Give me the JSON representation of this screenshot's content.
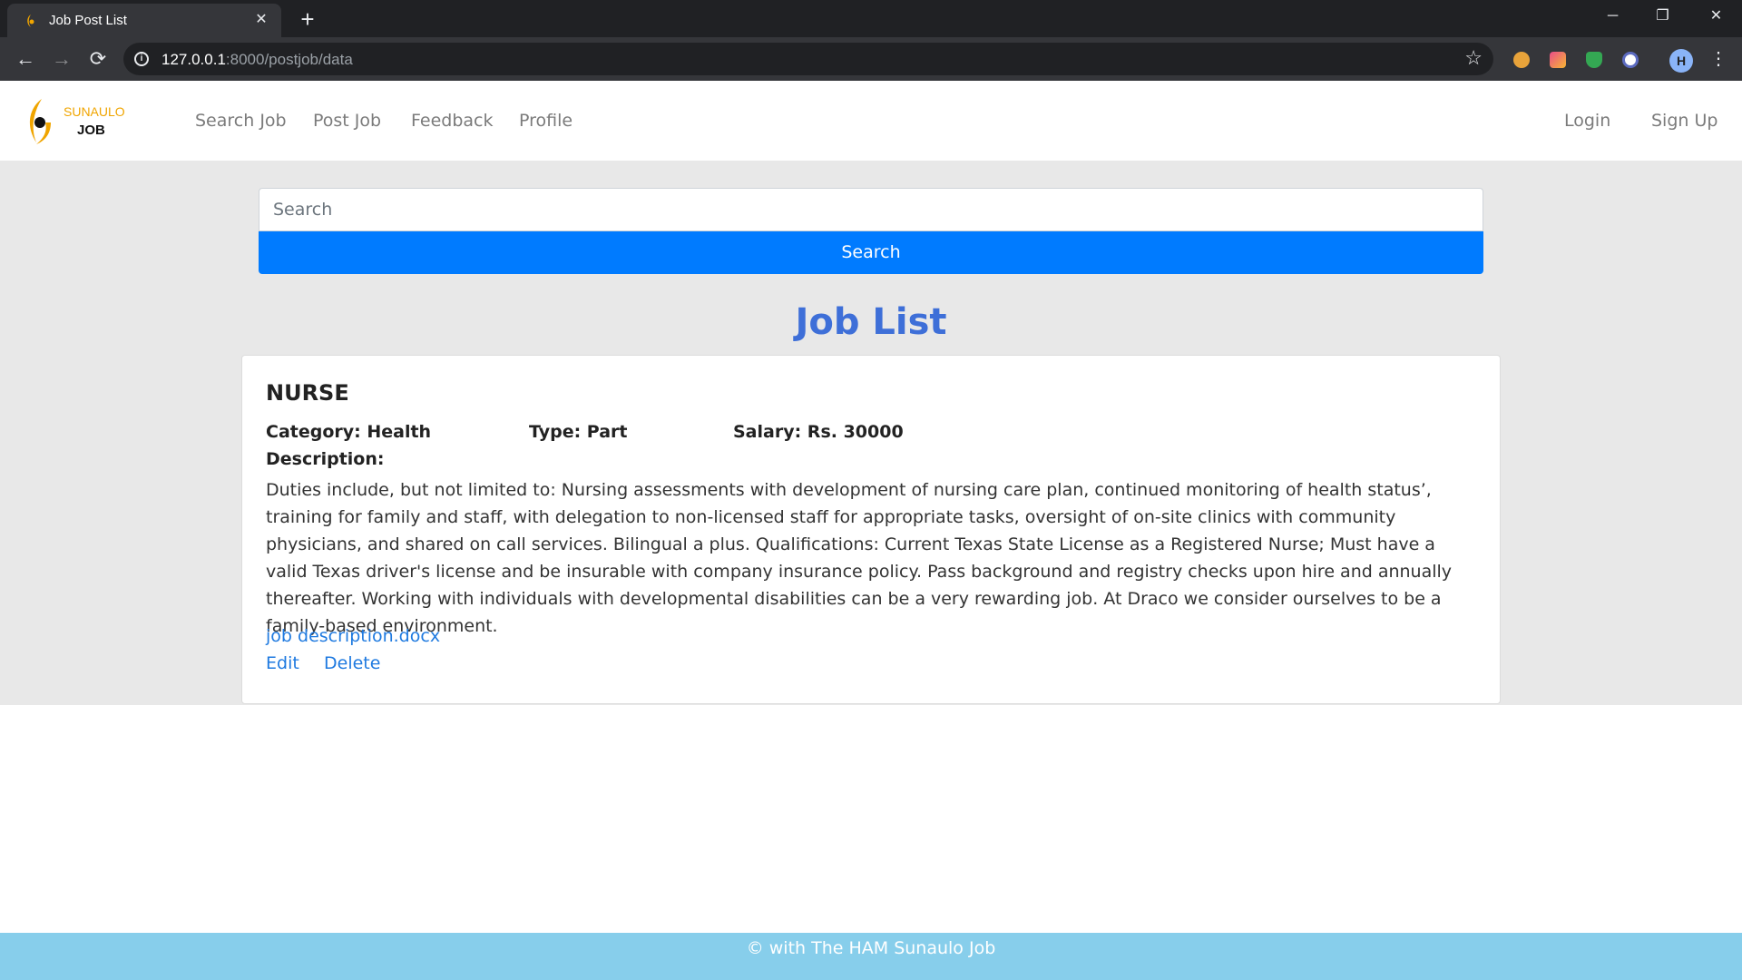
{
  "browser": {
    "tab_title": "Job Post List",
    "url_host": "127.0.0.1",
    "url_rest": ":8000/postjob/data",
    "profile_initial": "H"
  },
  "navbar": {
    "brand_top": "SUNAULO",
    "brand_bottom": "JOB",
    "links": [
      "Search Job",
      "Post Job",
      "Feedback",
      "Profile"
    ],
    "login": "Login",
    "signup": "Sign Up"
  },
  "search": {
    "placeholder": "Search",
    "button_label": "Search"
  },
  "page_title": "Job List",
  "job": {
    "title": "NURSE",
    "category": "Category: Health",
    "type": "Type: Part",
    "salary": "Salary: Rs. 30000",
    "description_label": "Description:",
    "description": "Duties include, but not limited to: Nursing assessments with development of nursing care plan, continued monitoring of health status’, training for family and staff, with delegation to non-licensed staff for appropriate tasks, oversight of on-site clinics with community physicians, and shared on call services. Bilingual a plus. Qualifications: Current Texas State License as a Registered Nurse; Must have a valid Texas driver's license and be insurable with company insurance policy. Pass background and registry checks upon hire and annually thereafter. Working with individuals with developmental disabilities can be a very rewarding job. At Draco we consider ourselves to be a family-based environment.",
    "file_link": "job description.docx",
    "edit": "Edit",
    "delete": "Delete"
  },
  "footer": "© with The HAM Sunaulo Job",
  "colors": {
    "primary_button": "#007bff",
    "title": "#3e6fd8",
    "link": "#1f7ae0",
    "footer": "#87ceeb",
    "brand": "#f0a500"
  }
}
